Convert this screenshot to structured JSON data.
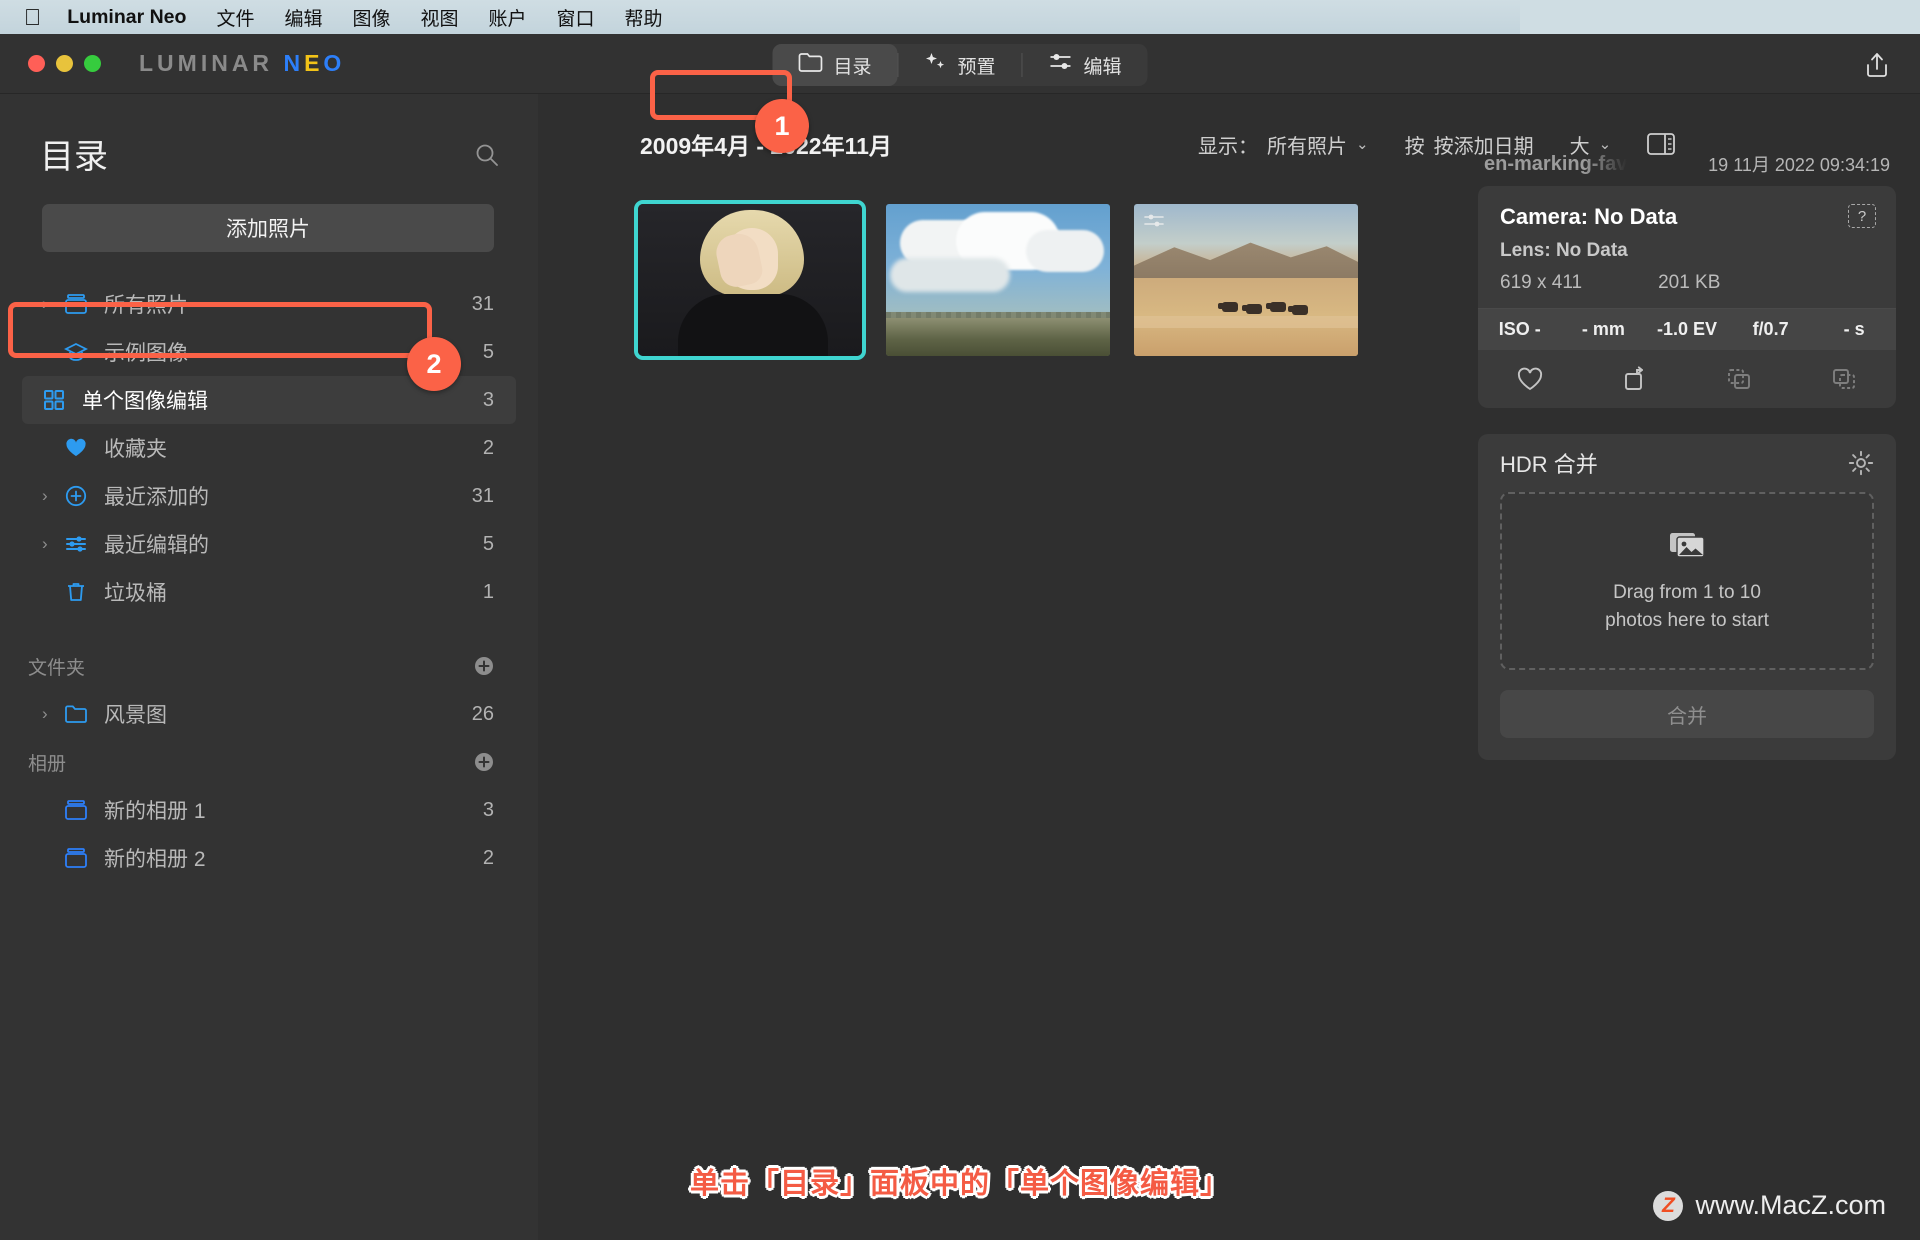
{
  "menubar": {
    "apple_icon": "apple-logo-icon",
    "app_name": "Luminar Neo",
    "items": [
      "文件",
      "编辑",
      "图像",
      "视图",
      "账户",
      "窗口",
      "帮助"
    ]
  },
  "titlebar": {
    "brand_part1": "LUMINAR",
    "brand_n": "N",
    "brand_e": "E",
    "brand_o": "O",
    "share_icon": "share-icon",
    "tabs": [
      {
        "label": "目录",
        "icon": "folder-icon",
        "active": true
      },
      {
        "label": "预置",
        "icon": "sparkles-icon",
        "active": false
      },
      {
        "label": "编辑",
        "icon": "sliders-icon",
        "active": false
      }
    ]
  },
  "sidebar": {
    "title": "目录",
    "search_icon": "search-icon",
    "add_photos_label": "添加照片",
    "items": [
      {
        "label": "所有照片",
        "count": "31",
        "icon": "album-icon",
        "chevron": "›",
        "selected": false
      },
      {
        "label": "示例图像",
        "count": "5",
        "icon": "graduation-icon",
        "chevron": "",
        "selected": false
      },
      {
        "label": "单个图像编辑",
        "count": "3",
        "icon": "grid-icon",
        "chevron": "",
        "selected": true
      },
      {
        "label": "收藏夹",
        "count": "2",
        "icon": "heart-icon",
        "chevron": "",
        "selected": false
      },
      {
        "label": "最近添加的",
        "count": "31",
        "icon": "plus-circle-icon",
        "chevron": "›",
        "selected": false
      },
      {
        "label": "最近编辑的",
        "count": "5",
        "icon": "sliders-icon",
        "chevron": "›",
        "selected": false
      },
      {
        "label": "垃圾桶",
        "count": "1",
        "icon": "trash-icon",
        "chevron": "",
        "selected": false
      }
    ],
    "folders_header": "文件夹",
    "folders_add_icon": "plus-circle-icon",
    "folders": [
      {
        "label": "风景图",
        "count": "26",
        "icon": "folder-icon",
        "chevron": "›"
      }
    ],
    "albums_header": "相册",
    "albums_add_icon": "plus-circle-icon",
    "albums": [
      {
        "label": "新的相册 1",
        "count": "3",
        "icon": "album-icon"
      },
      {
        "label": "新的相册 2",
        "count": "2",
        "icon": "album-icon"
      }
    ]
  },
  "filterbar": {
    "date_range": "2009年4月 - 2022年11月",
    "show_label": "显示：",
    "show_value": "所有照片",
    "sort_label": "按",
    "sort_value": "按添加日期",
    "size_value": "大",
    "chevron": "⌄",
    "view_toggle_icon": "split-view-icon"
  },
  "thumbnails": [
    {
      "name": "portrait-thumbnail",
      "selected": true,
      "badge": ""
    },
    {
      "name": "clouds-thumbnail",
      "selected": false,
      "badge": ""
    },
    {
      "name": "desert-thumbnail",
      "selected": false,
      "badge": "edit-badge-icon"
    }
  ],
  "info_panel": {
    "filename": "en-marking-fav",
    "datetime": "19 11月 2022 09:34:19",
    "camera": "Camera: No Data",
    "lens": "Lens: No Data",
    "dimensions": "619 x 411",
    "filesize": "201 KB",
    "help_label": "?",
    "exif": [
      "ISO -",
      "- mm",
      "-1.0 EV",
      "f/0.7",
      "- s"
    ],
    "actions": [
      {
        "name": "favorite-icon",
        "dim": false
      },
      {
        "name": "rotate-icon",
        "dim": false
      },
      {
        "name": "copy-dashed-icon",
        "dim": true
      },
      {
        "name": "copy-icon",
        "dim": true
      }
    ]
  },
  "hdr_panel": {
    "title": "HDR 合并",
    "gear_icon": "gear-icon",
    "dropzone_icon": "photos-stack-icon",
    "dropzone_line1": "Drag from 1 to 10",
    "dropzone_line2": "photos here to start",
    "merge_label": "合并"
  },
  "annotations": {
    "step1": "1",
    "step2": "2",
    "caption": "单击「目录」面板中的「单个图像编辑」"
  },
  "watermark": {
    "badge": "Z",
    "text": "www.MacZ.com"
  },
  "colors": {
    "accent_red": "#fb6247",
    "selection_cyan": "#3fd5d0",
    "icon_blue": "#2d9bf0",
    "caption_red": "#f45b44"
  }
}
